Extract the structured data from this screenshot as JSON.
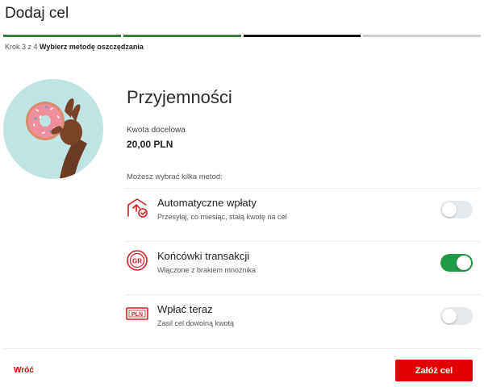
{
  "header": {
    "title": "Dodaj cel"
  },
  "progress": {
    "steps_total": 4,
    "steps_done": 2,
    "current_step": 3,
    "caption_prefix": "Krok 3 z 4",
    "caption_step": "Wybierz metodę oszczędzania"
  },
  "goal": {
    "image": "donut-hand-image",
    "title": "Przyjemności",
    "amount_label": "Kwota docelowa",
    "amount_value": "20,00 PLN"
  },
  "methods_label": "Możesz wybrać kilka metod:",
  "methods": [
    {
      "icon": "automatic-transfer-icon",
      "title": "Automatyczne wpłaty",
      "subtitle": "Przesyłaj, co miesiąc, stałą kwotę na cel",
      "enabled": false
    },
    {
      "icon": "round-up-gr-icon",
      "title": "Końcówki transakcji",
      "subtitle": "Włączone z brakiem mnożnika",
      "enabled": true
    },
    {
      "icon": "pln-banknote-icon",
      "title": "Wpłać teraz",
      "subtitle": "Zasil cel dowolną kwotą",
      "enabled": false
    }
  ],
  "footer": {
    "back_label": "Wróć",
    "submit_label": "Załóż cel"
  },
  "colors": {
    "accent_red": "#e30000",
    "progress_green": "#3a7d36",
    "toggle_on": "#1f9a47",
    "hero_bg": "#bfe4e3"
  }
}
